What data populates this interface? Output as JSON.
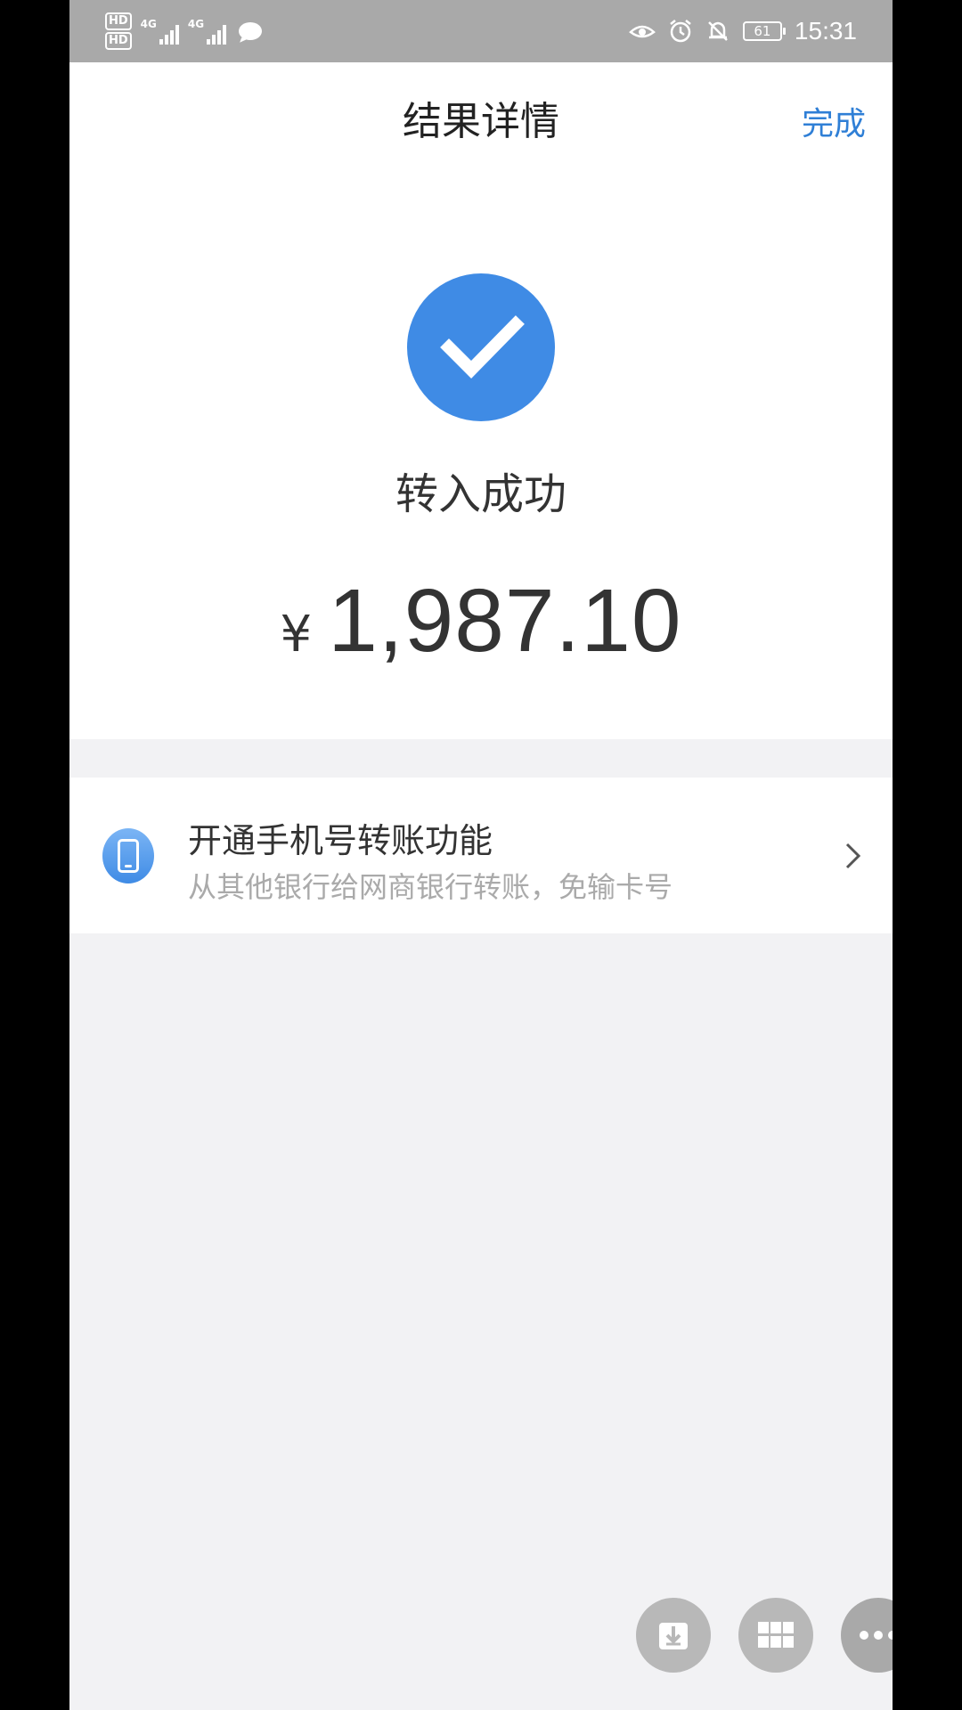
{
  "status_bar": {
    "hd1": "HD",
    "hd2": "HD",
    "net1": "4G",
    "net2": "4G",
    "battery": "61",
    "time": "15:31"
  },
  "header": {
    "title": "结果详情",
    "done_label": "完成"
  },
  "result": {
    "status_text": "转入成功",
    "currency_symbol": "¥",
    "amount": "1,987.10",
    "accent_color": "#3f8be5"
  },
  "promo": {
    "title": "开通手机号转账功能",
    "subtitle": "从其他银行给网商银行转账，免输卡号",
    "icon": "phone-icon"
  },
  "floating_actions": {
    "icons": [
      "download-icon",
      "grid-icon",
      "more-icon"
    ]
  },
  "colors": {
    "link": "#2f7fd6",
    "page_bg": "#f2f2f4",
    "status_bar_bg": "#a9a9a9"
  }
}
